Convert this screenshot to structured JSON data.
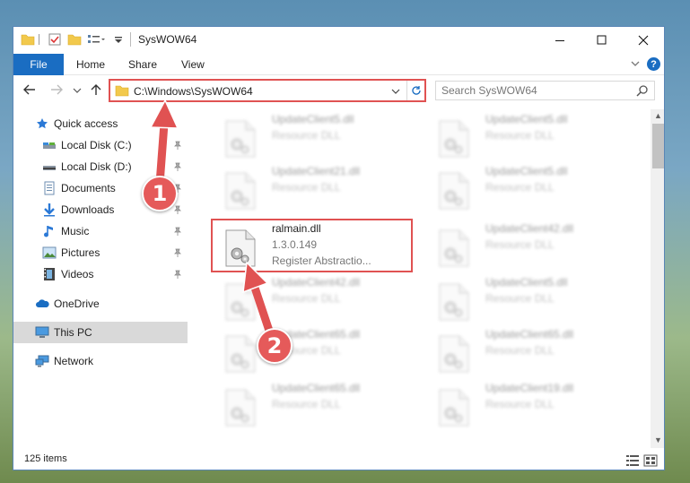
{
  "window": {
    "title": "SysWOW64"
  },
  "ribbon": {
    "tabs": [
      "File",
      "Home",
      "Share",
      "View"
    ],
    "help_label": "?"
  },
  "navbar": {
    "address": "C:\\Windows\\SysWOW64",
    "search_placeholder": "Search SysWOW64"
  },
  "sidebar": {
    "items": [
      {
        "label": "Quick access",
        "icon": "star-icon"
      },
      {
        "label": "Local Disk (C:)",
        "icon": "drive-icon"
      },
      {
        "label": "Local Disk (D:)",
        "icon": "drive-icon"
      },
      {
        "label": "Documents",
        "icon": "documents-icon"
      },
      {
        "label": "Downloads",
        "icon": "download-icon"
      },
      {
        "label": "Music",
        "icon": "music-icon"
      },
      {
        "label": "Pictures",
        "icon": "pictures-icon"
      },
      {
        "label": "Videos",
        "icon": "videos-icon"
      },
      {
        "label": "OneDrive",
        "icon": "onedrive-icon"
      },
      {
        "label": "This PC",
        "icon": "computer-icon"
      },
      {
        "label": "Network",
        "icon": "network-icon"
      }
    ],
    "selected": "This PC"
  },
  "files": {
    "left": [
      {
        "name": "UpdateClient5.dll",
        "desc": "Resource DLL"
      },
      {
        "name": "UpdateClient21.dll",
        "desc": "Resource DLL"
      },
      {
        "name": "ralmain.dll",
        "version": "1.3.0.149",
        "desc": "Register Abstractio..."
      },
      {
        "name": "UpdateClient42.dll",
        "desc": "Resource DLL"
      },
      {
        "name": "UpdateClient65.dll",
        "desc": "Resource DLL"
      },
      {
        "name": "UpdateClient65.dll",
        "desc": "Resource DLL"
      }
    ],
    "right": [
      {
        "name": "UpdateClient5.dll",
        "desc": "Resource DLL"
      },
      {
        "name": "UpdateClient5.dll",
        "desc": "Resource DLL"
      },
      {
        "name": "UpdateClient42.dll",
        "desc": "Resource DLL"
      },
      {
        "name": "UpdateClient5.dll",
        "desc": "Resource DLL"
      },
      {
        "name": "UpdateClient65.dll",
        "desc": "Resource DLL"
      },
      {
        "name": "UpdateClient19.dll",
        "desc": "Resource DLL"
      }
    ]
  },
  "status": {
    "count": "125 items"
  },
  "annotations": {
    "step1": "1",
    "step2": "2"
  },
  "colors": {
    "accent": "#1a6dc2",
    "annotation": "#e05252"
  }
}
